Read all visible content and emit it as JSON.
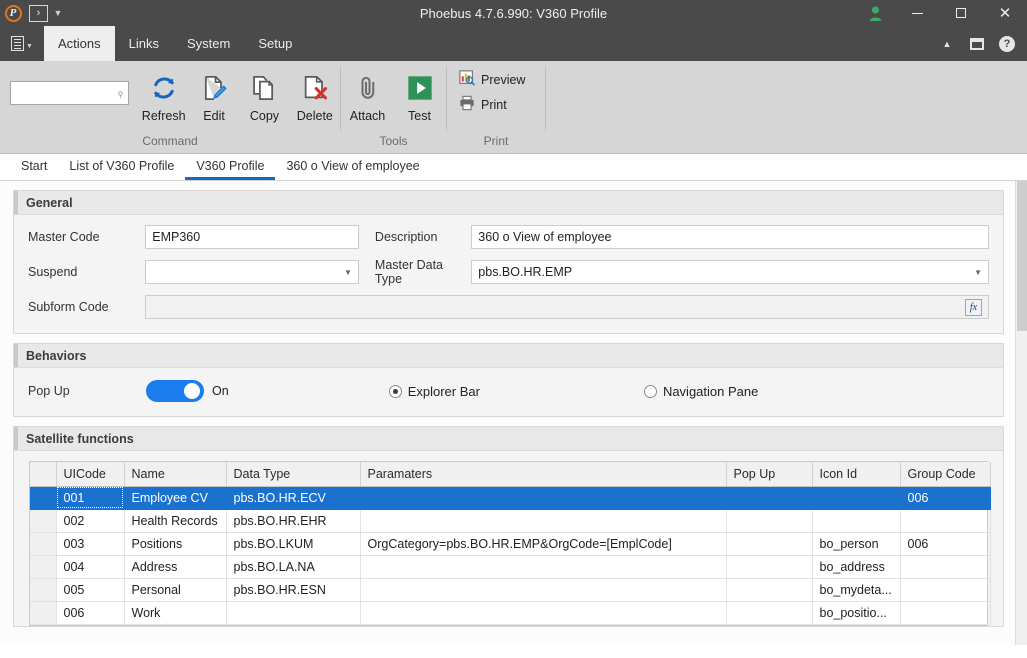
{
  "titlebar": {
    "app_logo": "phoebus-logo",
    "quick_access_glyph": "›",
    "title": "Phoebus 4.7.6.990: V360 Profile",
    "user_icon": "user-icon",
    "minimize_label": "–",
    "maximize_label": "□",
    "close_label": "✕",
    "user_color": "#3fa76a"
  },
  "menubar": {
    "app_menu_icon": "document-list-icon",
    "items": [
      {
        "label": "Actions",
        "active": true
      },
      {
        "label": "Links",
        "active": false
      },
      {
        "label": "System",
        "active": false
      },
      {
        "label": "Setup",
        "active": false
      }
    ],
    "collapse_icon": "chevron-up-icon",
    "window_icon": "window-icon",
    "help_icon": "help-icon",
    "help_glyph": "?"
  },
  "ribbon": {
    "search": {
      "value": "",
      "placeholder": "",
      "icon": "search-icon"
    },
    "groups": [
      {
        "label": "Command",
        "buttons": [
          {
            "label": "Refresh",
            "icon": "refresh-icon"
          },
          {
            "label": "Edit",
            "icon": "edit-pencil-icon"
          },
          {
            "label": "Copy",
            "icon": "copy-icon"
          },
          {
            "label": "Delete",
            "icon": "delete-icon"
          }
        ]
      },
      {
        "label": "Tools",
        "buttons": [
          {
            "label": "Attach",
            "icon": "paperclip-icon"
          },
          {
            "label": "Test",
            "icon": "play-icon"
          }
        ]
      },
      {
        "label": "Print",
        "small_buttons": [
          {
            "label": "Preview",
            "icon": "print-preview-icon"
          },
          {
            "label": "Print",
            "icon": "printer-icon"
          }
        ]
      }
    ]
  },
  "tabs": [
    {
      "label": "Start",
      "active": false
    },
    {
      "label": "List of V360 Profile",
      "active": false
    },
    {
      "label": "V360 Profile",
      "active": true
    },
    {
      "label": "360 o View of employee",
      "active": false
    }
  ],
  "general": {
    "title": "General",
    "master_code_label": "Master Code",
    "master_code_value": "EMP360",
    "description_label": "Description",
    "description_value": "360 o View of employee",
    "suspend_label": "Suspend",
    "suspend_value": "",
    "master_data_type_label": "Master Data Type",
    "master_data_type_value": "pbs.BO.HR.EMP",
    "subform_code_label": "Subform Code",
    "subform_code_value": "",
    "fx_button_label": "fx"
  },
  "behaviors": {
    "title": "Behaviors",
    "popup_label": "Pop Up",
    "popup_state": "On",
    "popup_on": true,
    "radio_explorer_label": "Explorer Bar",
    "radio_explorer_selected": true,
    "radio_navigation_label": "Navigation Pane",
    "radio_navigation_selected": false,
    "accent_color": "#1b7ced"
  },
  "satellite": {
    "title": "Satellite functions",
    "columns": [
      "UICode",
      "Name",
      "Data Type",
      "Paramaters",
      "Pop Up",
      "Icon Id",
      "Group Code"
    ],
    "selected_index": 0,
    "selection_color": "#1b72ce",
    "row_indicator": "→",
    "rows": [
      {
        "uicode": "001",
        "name": "Employee CV",
        "data_type": "pbs.BO.HR.ECV",
        "paramaters": "",
        "pop_up": "",
        "icon_id": "",
        "group_code": "006"
      },
      {
        "uicode": "002",
        "name": "Health Records",
        "data_type": "pbs.BO.HR.EHR",
        "paramaters": "",
        "pop_up": "",
        "icon_id": "",
        "group_code": ""
      },
      {
        "uicode": "003",
        "name": "Positions",
        "data_type": "pbs.BO.LKUM",
        "paramaters": "OrgCategory=pbs.BO.HR.EMP&OrgCode=[EmplCode]",
        "pop_up": "",
        "icon_id": "bo_person",
        "group_code": "006"
      },
      {
        "uicode": "004",
        "name": "Address",
        "data_type": "pbs.BO.LA.NA",
        "paramaters": "",
        "pop_up": "",
        "icon_id": "bo_address",
        "group_code": ""
      },
      {
        "uicode": "005",
        "name": "Personal",
        "data_type": "pbs.BO.HR.ESN",
        "paramaters": "",
        "pop_up": "",
        "icon_id": "bo_mydeta...",
        "group_code": ""
      },
      {
        "uicode": "006",
        "name": "Work",
        "data_type": "",
        "paramaters": "",
        "pop_up": "",
        "icon_id": "bo_positio...",
        "group_code": ""
      }
    ]
  }
}
